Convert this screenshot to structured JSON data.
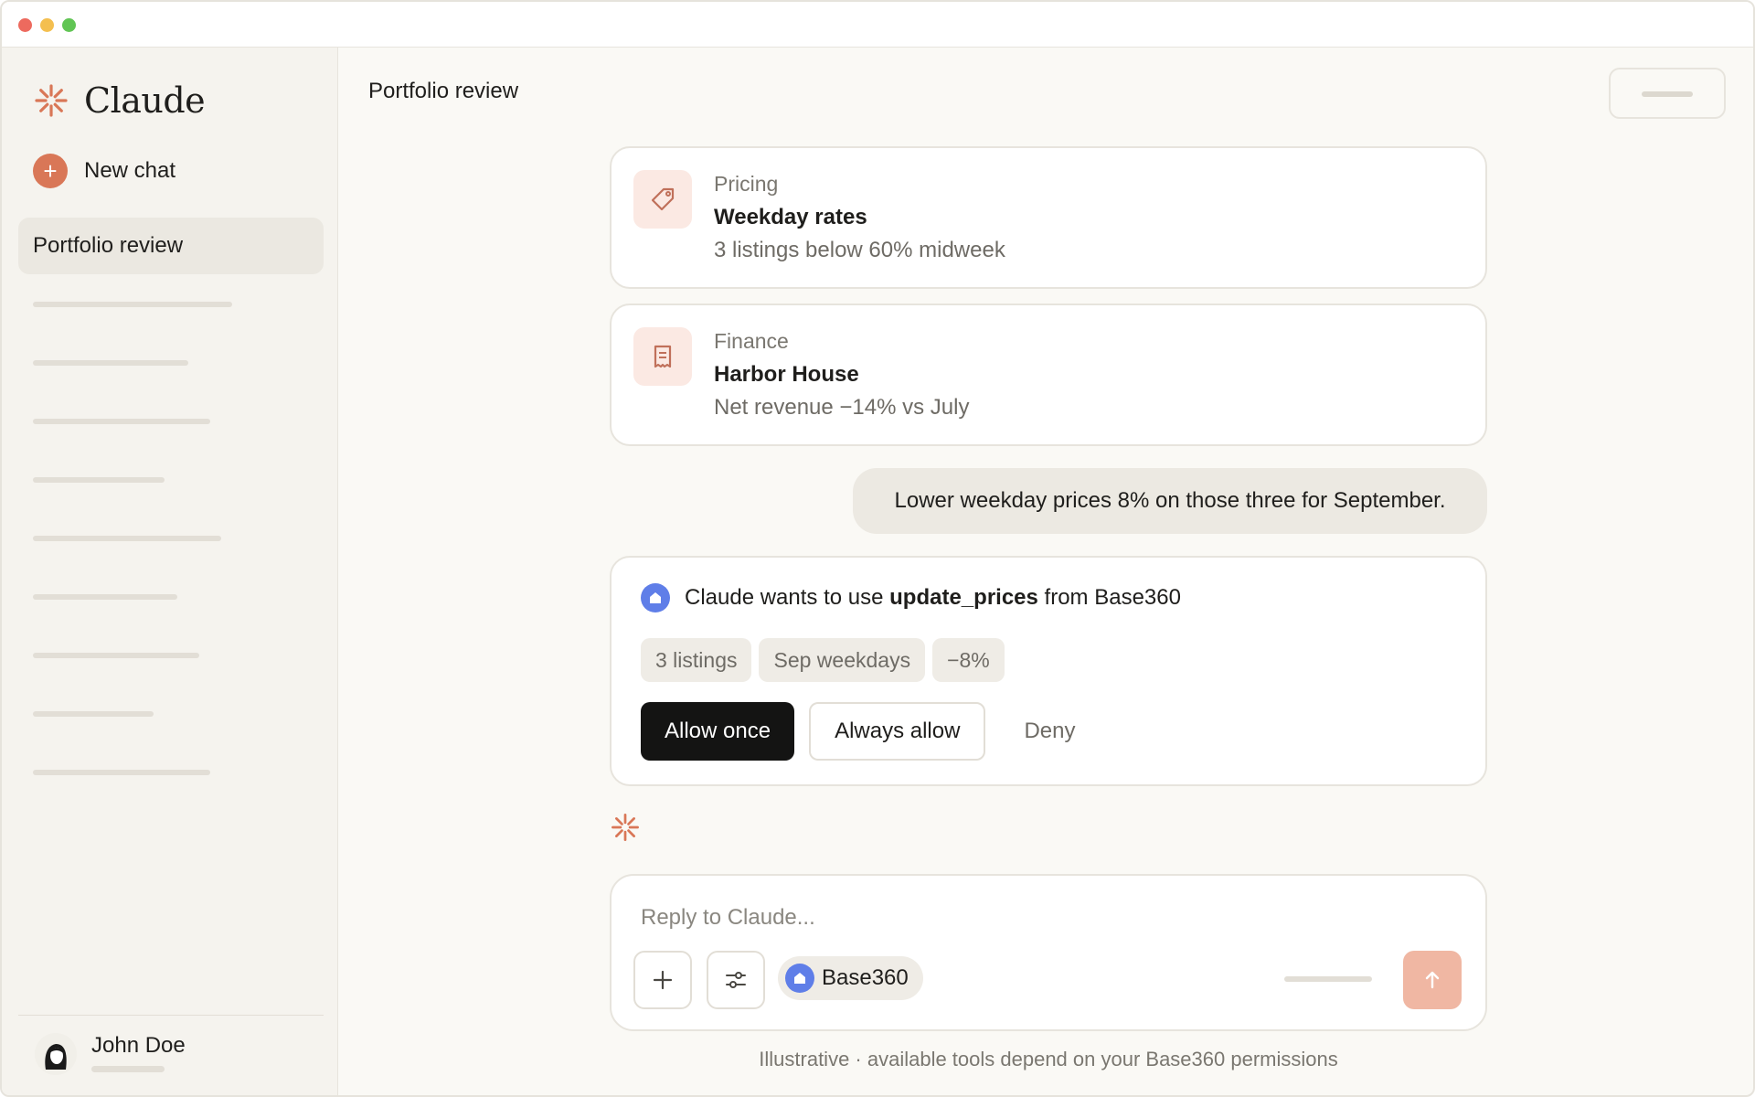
{
  "app": {
    "name": "Claude"
  },
  "sidebar": {
    "new_chat_label": "New chat",
    "active_chat": "Portfolio review",
    "user_name": "John Doe"
  },
  "header": {
    "title": "Portfolio review"
  },
  "cards": [
    {
      "category": "Pricing",
      "title": "Weekday rates",
      "subtitle": "3 listings below 60% midweek",
      "icon": "tag-icon"
    },
    {
      "category": "Finance",
      "title": "Harbor House",
      "subtitle": "Net revenue −14% vs July",
      "icon": "receipt-icon"
    }
  ],
  "user_message": "Lower weekday prices 8% on those three for September.",
  "permission": {
    "prefix": "Claude wants to use ",
    "tool": "update_prices",
    "suffix": " from Base360",
    "chips": [
      "3 listings",
      "Sep weekdays",
      "−8%"
    ],
    "allow_once": "Allow once",
    "always_allow": "Always allow",
    "deny": "Deny"
  },
  "composer": {
    "placeholder": "Reply to Claude...",
    "connector": "Base360"
  },
  "disclaimer": "Illustrative · available tools depend on your Base360 permissions",
  "colors": {
    "accent": "#d97757",
    "connector": "#5f7ee8",
    "primary_button": "#141413",
    "send_disabled": "#f0b7a3"
  }
}
